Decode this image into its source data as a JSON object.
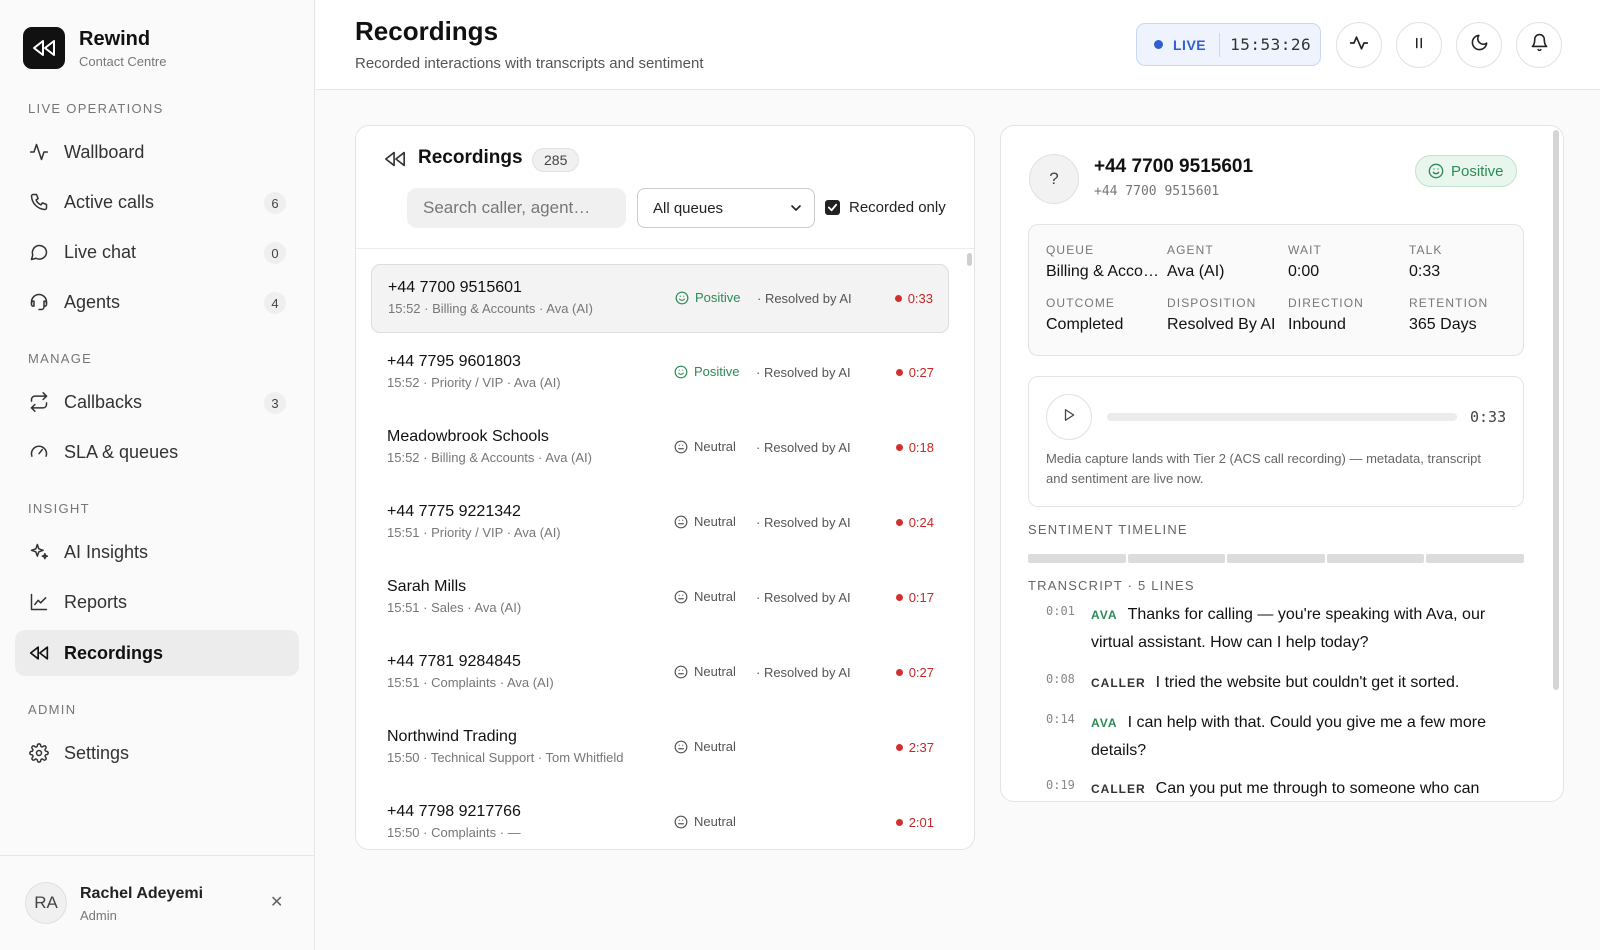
{
  "app": {
    "name": "Rewind",
    "subtitle": "Contact Centre"
  },
  "sidebar": {
    "sections": [
      {
        "label": "LIVE OPERATIONS"
      },
      {
        "label": "MANAGE"
      },
      {
        "label": "INSIGHT"
      },
      {
        "label": "ADMIN"
      }
    ],
    "items": [
      {
        "label": "Wallboard",
        "icon": "activity-icon"
      },
      {
        "label": "Active calls",
        "icon": "phone-icon",
        "count": "6"
      },
      {
        "label": "Live chat",
        "icon": "chat-icon",
        "count": "0"
      },
      {
        "label": "Agents",
        "icon": "headset-icon",
        "count": "4"
      },
      {
        "label": "Callbacks",
        "icon": "repeat-icon",
        "count": "3"
      },
      {
        "label": "SLA & queues",
        "icon": "gauge-icon"
      },
      {
        "label": "AI Insights",
        "icon": "sparkles-icon"
      },
      {
        "label": "Reports",
        "icon": "chart-line-icon"
      },
      {
        "label": "Recordings",
        "icon": "rewind-icon",
        "active": true
      },
      {
        "label": "Settings",
        "icon": "gear-icon"
      }
    ],
    "user": {
      "initials": "RA",
      "name": "Rachel Adeyemi",
      "role": "Admin"
    }
  },
  "header": {
    "title": "Recordings",
    "subtitle": "Recorded interactions with transcripts and sentiment",
    "live_label": "LIVE",
    "clock": "15:53:26",
    "accent": "#2f5fd0"
  },
  "list": {
    "title": "Recordings",
    "count": "285",
    "search_placeholder": "Search caller, agent…",
    "queue_filter": "All queues",
    "recorded_only_label": "Recorded only",
    "rows": [
      {
        "name": "+44 7700 9515601",
        "meta": "15:52 · Billing & Accounts · Ava (AI)",
        "sentiment": "Positive",
        "resolution": "· Resolved by AI",
        "duration": "0:33"
      },
      {
        "name": "+44 7795 9601803",
        "meta": "15:52 · Priority / VIP · Ava (AI)",
        "sentiment": "Positive",
        "resolution": "· Resolved by AI",
        "duration": "0:27"
      },
      {
        "name": "Meadowbrook Schools",
        "meta": "15:52 · Billing & Accounts · Ava (AI)",
        "sentiment": "Neutral",
        "resolution": "· Resolved by AI",
        "duration": "0:18"
      },
      {
        "name": "+44 7775 9221342",
        "meta": "15:51 · Priority / VIP · Ava (AI)",
        "sentiment": "Neutral",
        "resolution": "· Resolved by AI",
        "duration": "0:24"
      },
      {
        "name": "Sarah Mills",
        "meta": "15:51 · Sales · Ava (AI)",
        "sentiment": "Neutral",
        "resolution": "· Resolved by AI",
        "duration": "0:17"
      },
      {
        "name": "+44 7781 9284845",
        "meta": "15:51 · Complaints · Ava (AI)",
        "sentiment": "Neutral",
        "resolution": "· Resolved by AI",
        "duration": "0:27"
      },
      {
        "name": "Northwind Trading",
        "meta": "15:50 · Technical Support · Tom Whitfield",
        "sentiment": "Neutral",
        "resolution": "",
        "duration": "2:37"
      },
      {
        "name": "+44 7798 9217766",
        "meta": "15:50 · Complaints · —",
        "sentiment": "Neutral",
        "resolution": "",
        "duration": "2:01"
      }
    ]
  },
  "detail": {
    "avatar": "?",
    "name": "+44 7700 9515601",
    "number": "+44 7700 9515601",
    "sentiment": "Positive",
    "meta": [
      {
        "key": "QUEUE",
        "value": "Billing & Accounts"
      },
      {
        "key": "AGENT",
        "value": "Ava (AI)"
      },
      {
        "key": "WAIT",
        "value": "0:00"
      },
      {
        "key": "TALK",
        "value": "0:33"
      },
      {
        "key": "OUTCOME",
        "value": "Completed"
      },
      {
        "key": "DISPOSITION",
        "value": "Resolved By AI"
      },
      {
        "key": "DIRECTION",
        "value": "Inbound"
      },
      {
        "key": "RETENTION",
        "value": "365 Days"
      }
    ],
    "player": {
      "time": "0:33",
      "note": "Media capture lands with Tier 2 (ACS call recording) — metadata, transcript and sentiment are live now."
    },
    "timeline_label": "SENTIMENT TIMELINE",
    "transcript_label": "TRANSCRIPT · 5 LINES",
    "transcript": [
      {
        "time": "0:01",
        "speaker": "AVA",
        "text": "Thanks for calling — you're speaking with Ava, our virtual assistant. How can I help today?"
      },
      {
        "time": "0:08",
        "speaker": "CALLER",
        "text": "I tried the website but couldn't get it sorted."
      },
      {
        "time": "0:14",
        "speaker": "AVA",
        "text": "I can help with that. Could you give me a few more details?"
      },
      {
        "time": "0:19",
        "speaker": "CALLER",
        "text": "Can you put me through to someone who can help?"
      }
    ]
  },
  "colors": {
    "positive": "#2d8a55",
    "duration": "#c62828"
  }
}
